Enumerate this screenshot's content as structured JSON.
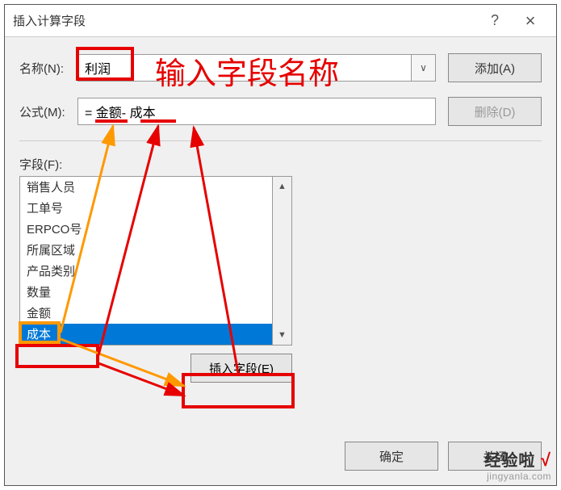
{
  "dialog": {
    "title": "插入计算字段",
    "help": "?",
    "close": "×"
  },
  "labels": {
    "name": "名称(N):",
    "formula": "公式(M):",
    "fields": "字段(F):"
  },
  "inputs": {
    "name_value": "利润",
    "formula_value": "= 金额- 成本"
  },
  "buttons": {
    "add": "添加(A)",
    "delete": "删除(D)",
    "insert_field": "插入字段(E)",
    "ok": "确定",
    "close": "关闭"
  },
  "field_list": [
    {
      "label": "销售人员",
      "selected": false
    },
    {
      "label": "工单号",
      "selected": false
    },
    {
      "label": "ERPCO号",
      "selected": false
    },
    {
      "label": "所属区域",
      "selected": false
    },
    {
      "label": "产品类别",
      "selected": false
    },
    {
      "label": "数量",
      "selected": false
    },
    {
      "label": "金额",
      "selected": false
    },
    {
      "label": "成本",
      "selected": true
    }
  ],
  "annotation": {
    "hint": "输入字段名称"
  },
  "watermark": {
    "line1": "经验啦",
    "check": "√",
    "line2": "jingyanla.com"
  },
  "icons": {
    "dropdown": "∨",
    "scroll_up": "▲",
    "scroll_down": "▼"
  }
}
